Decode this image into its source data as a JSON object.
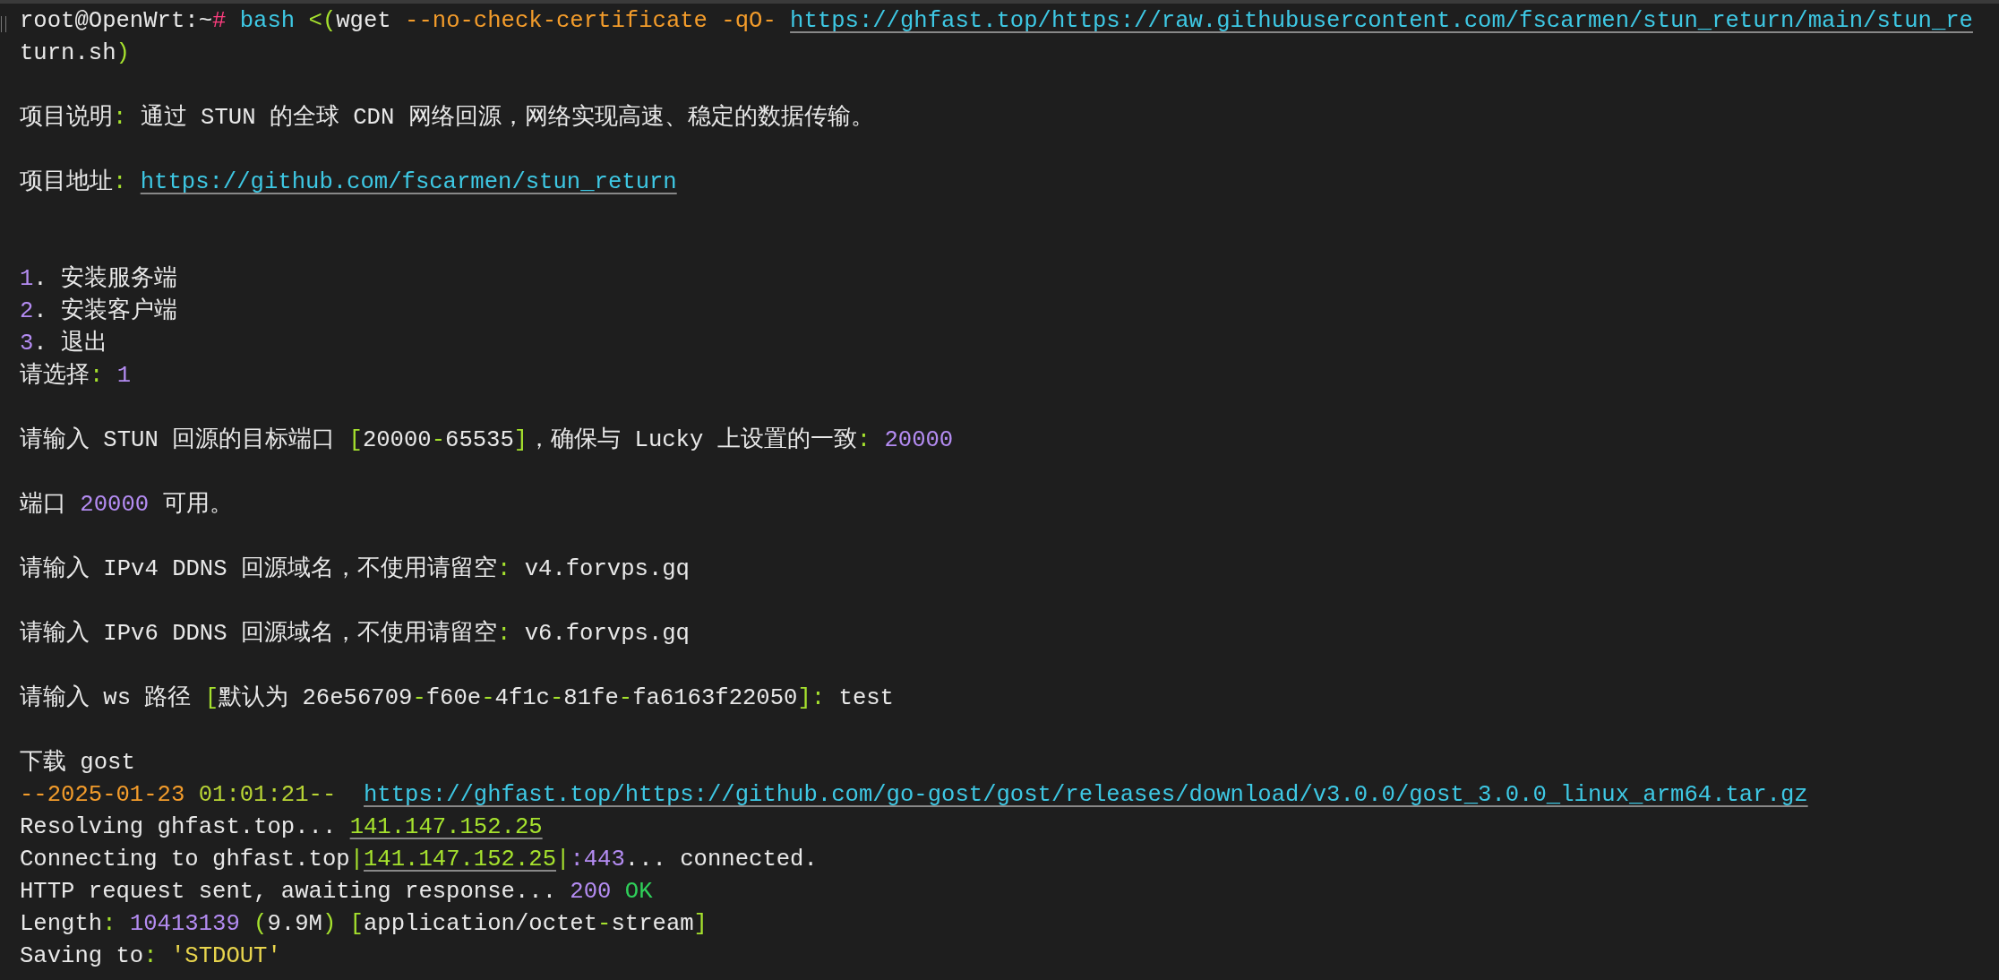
{
  "terminal": {
    "lines": [
      {
        "kind": "text",
        "segments": [
          {
            "text": "root@OpenWrt:~",
            "color": "#e8e8e8"
          },
          {
            "text": "# ",
            "color": "#ff3d7f"
          },
          {
            "text": "bash ",
            "color": "#3ec8e4"
          },
          {
            "text": "<(",
            "color": "#a6e22e"
          },
          {
            "text": "wget ",
            "color": "#e8e8e8"
          },
          {
            "text": "--no-check-certificate -qO- ",
            "color": "#f39c2b"
          },
          {
            "text": "https://ghfast.top/https://raw.githubusercontent.com/fscarmen/stun_return/main/stun_re",
            "color": "#3ec8e4",
            "kind": "link"
          }
        ]
      },
      {
        "kind": "text",
        "segments": [
          {
            "text": "turn.sh",
            "color": "#e8e8e8"
          },
          {
            "text": ")",
            "color": "#a6e22e"
          }
        ]
      },
      {
        "kind": "blank"
      },
      {
        "kind": "text",
        "segments": [
          {
            "text": "项目说明",
            "color": "#e8e8e8"
          },
          {
            "text": ": ",
            "color": "#a6e22e"
          },
          {
            "text": "通过 STUN 的全球 CDN 网络回源，网络实现高速、稳定的数据传输。",
            "color": "#e8e8e8"
          }
        ]
      },
      {
        "kind": "blank"
      },
      {
        "kind": "text",
        "segments": [
          {
            "text": "项目地址",
            "color": "#e8e8e8"
          },
          {
            "text": ": ",
            "color": "#a6e22e"
          },
          {
            "text": "https://github.com/fscarmen/stun_return",
            "color": "#3ec8e4",
            "kind": "link"
          }
        ]
      },
      {
        "kind": "blank"
      },
      {
        "kind": "blank"
      },
      {
        "kind": "text",
        "segments": [
          {
            "text": "1",
            "color": "#b48cf2"
          },
          {
            "text": ". 安装服务端",
            "color": "#e8e8e8"
          }
        ]
      },
      {
        "kind": "text",
        "segments": [
          {
            "text": "2",
            "color": "#b48cf2"
          },
          {
            "text": ". 安装客户端",
            "color": "#e8e8e8"
          }
        ]
      },
      {
        "kind": "text",
        "segments": [
          {
            "text": "3",
            "color": "#b48cf2"
          },
          {
            "text": ". 退出",
            "color": "#e8e8e8"
          }
        ]
      },
      {
        "kind": "text",
        "segments": [
          {
            "text": "请选择",
            "color": "#e8e8e8"
          },
          {
            "text": ": ",
            "color": "#a6e22e"
          },
          {
            "text": "1",
            "color": "#b48cf2"
          }
        ]
      },
      {
        "kind": "blank"
      },
      {
        "kind": "text",
        "segments": [
          {
            "text": "请输入 STUN 回源的目标端口 ",
            "color": "#e8e8e8"
          },
          {
            "text": "[",
            "color": "#a6e22e"
          },
          {
            "text": "20000",
            "color": "#e8e8e8"
          },
          {
            "text": "-",
            "color": "#a6e22e"
          },
          {
            "text": "65535",
            "color": "#e8e8e8"
          },
          {
            "text": "]",
            "color": "#a6e22e"
          },
          {
            "text": "，确保与 Lucky 上设置的一致",
            "color": "#e8e8e8"
          },
          {
            "text": ": ",
            "color": "#a6e22e"
          },
          {
            "text": "20000",
            "color": "#b48cf2"
          }
        ]
      },
      {
        "kind": "blank"
      },
      {
        "kind": "text",
        "segments": [
          {
            "text": "端口 ",
            "color": "#e8e8e8"
          },
          {
            "text": "20000",
            "color": "#b48cf2"
          },
          {
            "text": " 可用。",
            "color": "#e8e8e8"
          }
        ]
      },
      {
        "kind": "blank"
      },
      {
        "kind": "text",
        "segments": [
          {
            "text": "请输入 IPv4 DDNS 回源域名，不使用请留空",
            "color": "#e8e8e8"
          },
          {
            "text": ": ",
            "color": "#a6e22e"
          },
          {
            "text": "v4.forvps.gq",
            "color": "#e8e8e8"
          }
        ]
      },
      {
        "kind": "blank"
      },
      {
        "kind": "text",
        "segments": [
          {
            "text": "请输入 IPv6 DDNS 回源域名，不使用请留空",
            "color": "#e8e8e8"
          },
          {
            "text": ": ",
            "color": "#a6e22e"
          },
          {
            "text": "v6.forvps.gq",
            "color": "#e8e8e8"
          }
        ]
      },
      {
        "kind": "blank"
      },
      {
        "kind": "text",
        "segments": [
          {
            "text": "请输入 ws 路径 ",
            "color": "#e8e8e8"
          },
          {
            "text": "[",
            "color": "#a6e22e"
          },
          {
            "text": "默认为 26e56709",
            "color": "#e8e8e8"
          },
          {
            "text": "-",
            "color": "#a6e22e"
          },
          {
            "text": "f60e",
            "color": "#e8e8e8"
          },
          {
            "text": "-",
            "color": "#a6e22e"
          },
          {
            "text": "4f1c",
            "color": "#e8e8e8"
          },
          {
            "text": "-",
            "color": "#a6e22e"
          },
          {
            "text": "81fe",
            "color": "#e8e8e8"
          },
          {
            "text": "-",
            "color": "#a6e22e"
          },
          {
            "text": "fa6163f22050",
            "color": "#e8e8e8"
          },
          {
            "text": "]: ",
            "color": "#a6e22e"
          },
          {
            "text": "test",
            "color": "#e8e8e8"
          }
        ]
      },
      {
        "kind": "blank"
      },
      {
        "kind": "text",
        "segments": [
          {
            "text": "下载 gost",
            "color": "#e8e8e8"
          }
        ]
      },
      {
        "kind": "text",
        "segments": [
          {
            "text": "--2025-01-23 ",
            "color": "#f39c2b"
          },
          {
            "text": "01:01:21--  ",
            "color": "#b8d435"
          },
          {
            "text": "https://ghfast.top/https://github.com/go-gost/gost/releases/download/v3.0.0/gost_3.0.0_linux_arm64.tar.gz",
            "color": "#3ec8e4",
            "kind": "link"
          }
        ]
      },
      {
        "kind": "text",
        "segments": [
          {
            "text": "Resolving ghfast.top... ",
            "color": "#e8e8e8"
          },
          {
            "text": "141.147.152.25",
            "color": "#a6e22e",
            "kind": "link"
          }
        ]
      },
      {
        "kind": "text",
        "segments": [
          {
            "text": "Connecting to ghfast.top",
            "color": "#e8e8e8"
          },
          {
            "text": "|",
            "color": "#a6e22e"
          },
          {
            "text": "141.147.152.25",
            "color": "#a6e22e",
            "kind": "link"
          },
          {
            "text": "|",
            "color": "#a6e22e"
          },
          {
            "text": ":443",
            "color": "#b48cf2"
          },
          {
            "text": "... connected.",
            "color": "#e8e8e8"
          }
        ]
      },
      {
        "kind": "text",
        "segments": [
          {
            "text": "HTTP request sent, awaiting response... ",
            "color": "#e8e8e8"
          },
          {
            "text": "200",
            "color": "#b48cf2"
          },
          {
            "text": " OK",
            "color": "#2fd05a"
          }
        ]
      },
      {
        "kind": "text",
        "segments": [
          {
            "text": "Length",
            "color": "#e8e8e8"
          },
          {
            "text": ": ",
            "color": "#a6e22e"
          },
          {
            "text": "10413139",
            "color": "#b48cf2"
          },
          {
            "text": " (",
            "color": "#a6e22e"
          },
          {
            "text": "9.9M",
            "color": "#e8e8e8"
          },
          {
            "text": ") [",
            "color": "#a6e22e"
          },
          {
            "text": "application/octet",
            "color": "#e8e8e8"
          },
          {
            "text": "-",
            "color": "#a6e22e"
          },
          {
            "text": "stream",
            "color": "#e8e8e8"
          },
          {
            "text": "]",
            "color": "#a6e22e"
          }
        ]
      },
      {
        "kind": "text",
        "segments": [
          {
            "text": "Saving to",
            "color": "#e8e8e8"
          },
          {
            "text": ": ",
            "color": "#a6e22e"
          },
          {
            "text": "'STDOUT'",
            "color": "#e8d44d"
          }
        ]
      }
    ]
  }
}
